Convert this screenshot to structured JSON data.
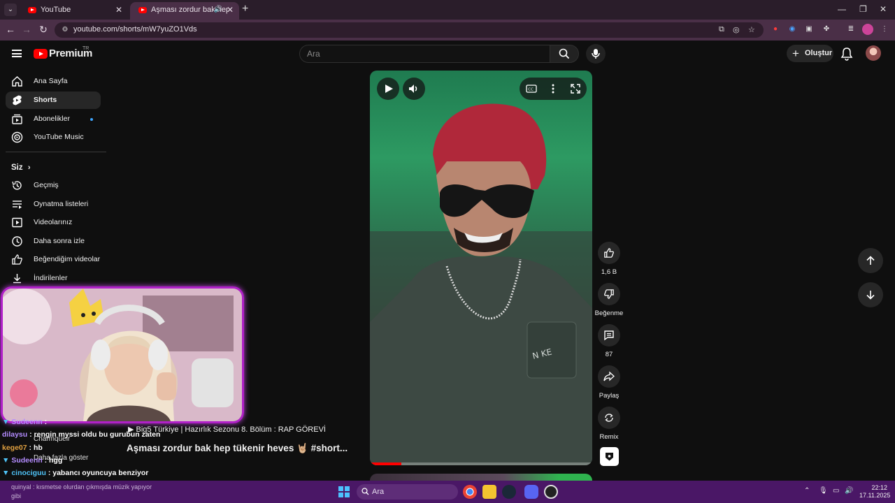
{
  "browser": {
    "tabs": [
      {
        "title": "YouTube",
        "active": false
      },
      {
        "title": "Aşması zordur bak hep tüke",
        "active": true
      }
    ],
    "url": "youtube.com/shorts/mW7yuZO1Vds"
  },
  "header": {
    "logo_text": "Premium",
    "region": "TR",
    "search_placeholder": "Ara",
    "create_label": "Oluştur"
  },
  "sidebar": {
    "main_items": [
      {
        "label": "Ana Sayfa",
        "icon": "home-icon"
      },
      {
        "label": "Shorts",
        "icon": "shorts-icon",
        "active": true
      },
      {
        "label": "Abonelikler",
        "icon": "subscriptions-icon"
      },
      {
        "label": "YouTube Music",
        "icon": "music-icon"
      }
    ],
    "section_title": "Siz",
    "you_items": [
      {
        "label": "Geçmiş",
        "icon": "history-icon"
      },
      {
        "label": "Oynatma listeleri",
        "icon": "playlists-icon"
      },
      {
        "label": "Videolarınız",
        "icon": "your-videos-icon"
      },
      {
        "label": "Daha sonra izle",
        "icon": "watch-later-icon"
      },
      {
        "label": "Beğendiğim videolar",
        "icon": "liked-icon"
      },
      {
        "label": "İndirilenler",
        "icon": "downloads-icon"
      }
    ]
  },
  "player": {
    "progress_fraction": 0.14
  },
  "actions": {
    "likes": "1,6 B",
    "dislike_label": "Beğenme",
    "comments": "87",
    "share_label": "Paylaş",
    "remix_label": "Remix"
  },
  "video": {
    "playlist_title": "▶ Big5 Türkiye | Hazırlık Sezonu 8. Bölüm : RAP GÖREVİ",
    "title": "Aşması zordur bak hep tükenir heves 🤘🏼 #short..."
  },
  "chat": [
    {
      "user": "Sudeenn",
      "message": ":",
      "color": "#b48cff"
    },
    {
      "user": "dilaysu",
      "message": ": rengin myssi oldu bu gurubun zaten",
      "color": "#b48cff"
    },
    {
      "user": "kege07",
      "message": ": hb",
      "color": "#e0a040"
    },
    {
      "user": "Sudeenn",
      "message": ": hgg",
      "color": "#b48cff"
    },
    {
      "user": "cinociguu",
      "message": ": yabancı oyuncuya benziyor",
      "color": "#4fc3f7"
    }
  ],
  "overlay_ghost": {
    "channel": "Charmqueir",
    "more": "Daha fazla göster"
  },
  "taskbar": {
    "notification_line1": "quinyal : kısmetse olurdan çıkmışda müzik yapıyor",
    "notification_line2": "gibi",
    "search_label": "Ara",
    "time": "22:12",
    "date": "17.11.2025"
  }
}
